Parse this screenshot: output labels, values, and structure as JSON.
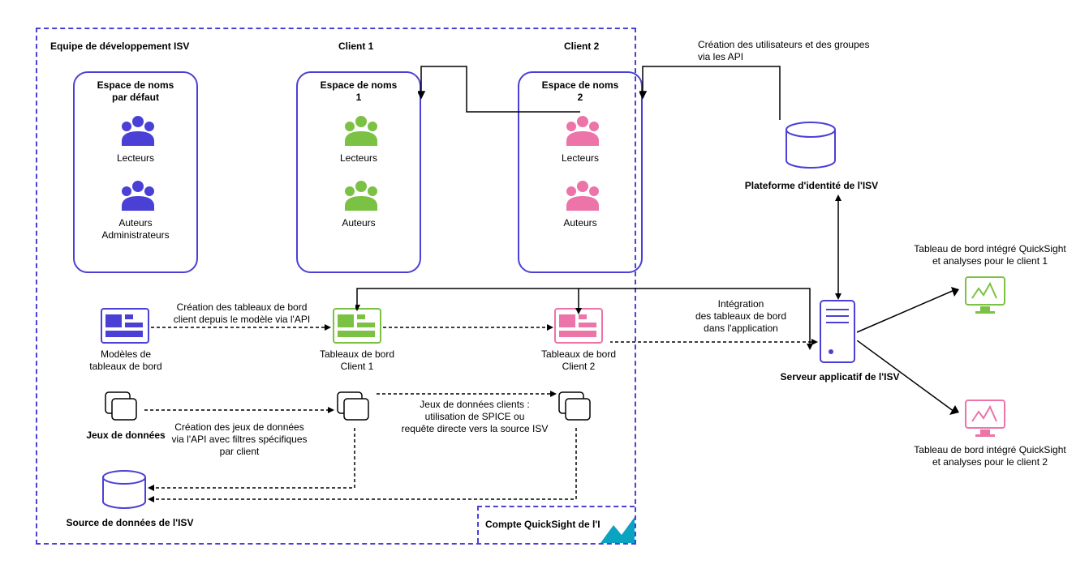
{
  "outer": {
    "isv_team": "Equipe de développement ISV",
    "client1": "Client 1",
    "client2": "Client 2"
  },
  "namespaces": {
    "default": {
      "title1": "Espace de noms",
      "title2": "par défaut",
      "readers": "Lecteurs",
      "authors1": "Auteurs",
      "authors2": "Administrateurs"
    },
    "c1": {
      "title1": "Espace de noms",
      "title2": "1",
      "readers": "Lecteurs",
      "authors": "Auteurs"
    },
    "c2": {
      "title1": "Espace de noms",
      "title2": "2",
      "readers": "Lecteurs",
      "authors": "Auteurs"
    }
  },
  "identity": {
    "creation_line1": "Création des utilisateurs et des groupes",
    "creation_line2": "via les API",
    "platform": "Plateforme d'identité de l'ISV"
  },
  "dashboards": {
    "models1": "Modèles de",
    "models2": "tableaux de bord",
    "create1": "Création des tableaux de bord",
    "create2": "client depuis le modèle via l'API",
    "c1_1": "Tableaux de bord",
    "c1_2": "Client 1",
    "c2_1": "Tableaux de bord",
    "c2_2": "Client 2",
    "integration1": "Intégration",
    "integration2": "des tableaux de bord",
    "integration3": "dans l'application"
  },
  "datasets": {
    "label": "Jeux de données",
    "create1": "Création des jeux de données",
    "create2": "via l'API avec filtres spécifiques",
    "create3": "par client",
    "client1": "Jeux de données clients :",
    "client2": "utilisation de SPICE ou",
    "client3": "requête directe vers la source ISV"
  },
  "datasource": "Source de données de l'ISV",
  "qs_account": "Compte QuickSight de l'ISV",
  "server": "Serveur applicatif de l'ISV",
  "embedded": {
    "c1_1": "Tableau de bord intégré QuickSight",
    "c1_2": "et analyses pour le client 1",
    "c2_1": "Tableau de bord intégré QuickSight",
    "c2_2": "et analyses pour le client 2"
  },
  "colors": {
    "purple": "#4a40d6",
    "green": "#7bc143",
    "pink": "#ec74a8",
    "teal": "#0aa3c2",
    "black": "#000"
  }
}
